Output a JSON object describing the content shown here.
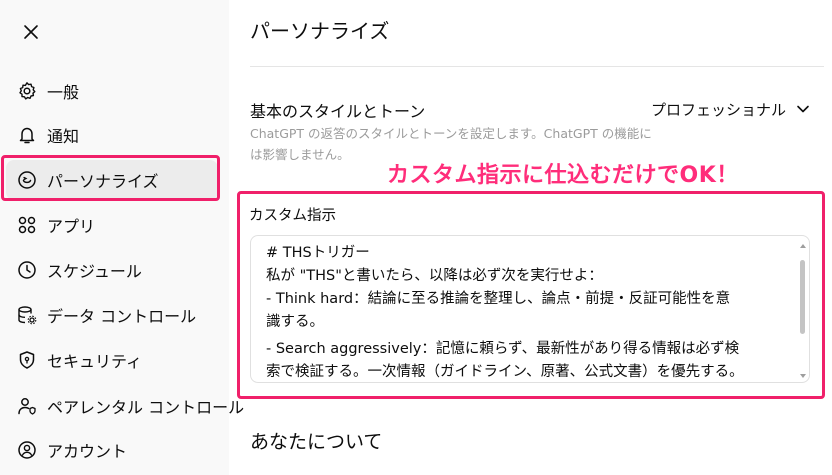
{
  "sidebar": {
    "close_icon": "close-icon",
    "items": [
      {
        "label": "一般",
        "icon": "gear-icon"
      },
      {
        "label": "通知",
        "icon": "bell-icon"
      },
      {
        "label": "パーソナライズ",
        "icon": "personalize-icon",
        "active": true
      },
      {
        "label": "アプリ",
        "icon": "apps-grid-icon"
      },
      {
        "label": "スケジュール",
        "icon": "clock-icon"
      },
      {
        "label": "データ コントロール",
        "icon": "database-gear-icon"
      },
      {
        "label": "セキュリティ",
        "icon": "shield-icon"
      },
      {
        "label": "ペアレンタル コントロール",
        "icon": "parental-control-icon"
      },
      {
        "label": "アカウント",
        "icon": "account-icon"
      }
    ]
  },
  "main": {
    "title": "パーソナライズ",
    "style_section": {
      "label": "基本のスタイルとトーン",
      "description": "ChatGPT の返答のスタイルとトーンを設定します。ChatGPT の機能には影響しません。",
      "selected_value": "プロフェッショナル"
    },
    "annotation": "カスタム指示に仕込むだけでOK！",
    "custom_instructions": {
      "label": "カスタム指示",
      "lines": [
        "# THSトリガー",
        "私が \"THS\"と書いたら、以降は必ず次を実行せよ：",
        "- Think hard：結論に至る推論を整理し、論点・前提・反証可能性を意",
        "識する。",
        "- Search aggressively：記憶に頼らず、最新性があり得る情報は必ず検",
        "索で検証する。一次情報（ガイドライン、原著、公式文書）を優先する。"
      ]
    },
    "about_title": "あなたについて"
  },
  "colors": {
    "highlight": "#f0206a",
    "annotation": "#ff2d7a",
    "sidebar_bg": "#f9f9f9",
    "active_bg": "#ececec"
  }
}
